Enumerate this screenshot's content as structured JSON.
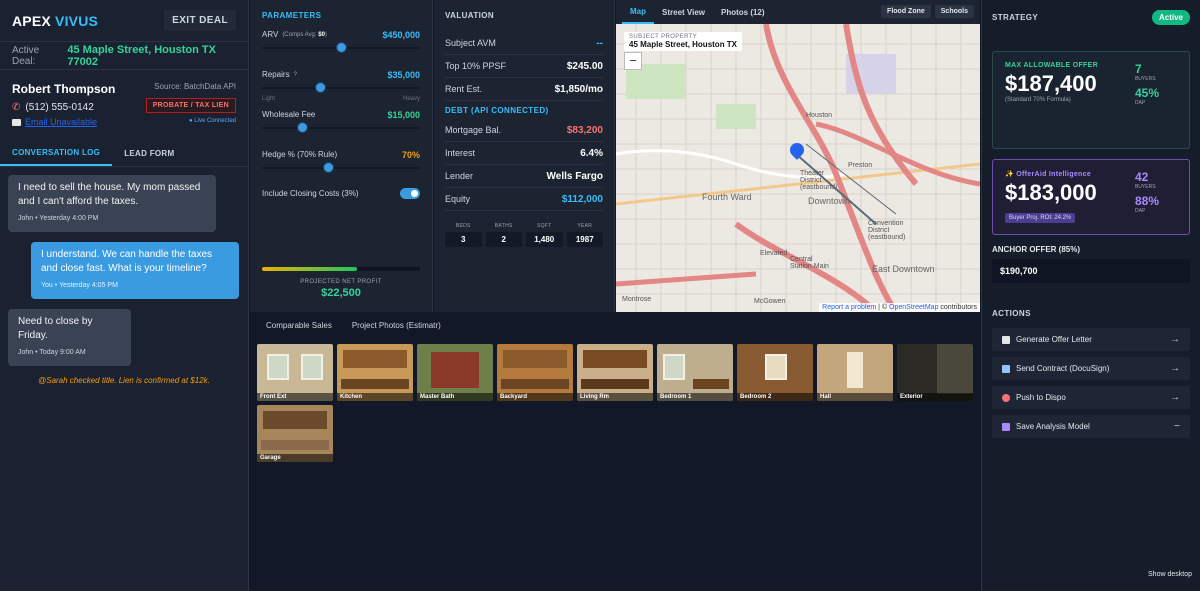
{
  "brand": {
    "part1": "APEX",
    "part2": "VIVUS"
  },
  "exit_label": "EXIT DEAL",
  "deal": {
    "label": "Active Deal:",
    "address": "45 Maple Street, Houston TX 77002"
  },
  "contact": {
    "name": "Robert Thompson",
    "phone": "(512) 555-0142",
    "email": "Email Unavailable",
    "source": "Source: BatchData API",
    "tag": "PROBATE / TAX LIEN",
    "status": "● Live Connected"
  },
  "left_tabs": [
    "CONVERSATION LOG",
    "LEAD FORM"
  ],
  "messages": [
    {
      "text": "I need to sell the house. My mom passed and I can't afford the taxes.",
      "meta": "John • Yesterday 4:00 PM",
      "dir": "in"
    },
    {
      "text": "I understand. We can handle the taxes and close fast. What is your timeline?",
      "meta": "You • Yesterday 4:05 PM",
      "dir": "out"
    },
    {
      "text": "Need to close by Friday.",
      "meta": "John • Today 9:00 AM",
      "dir": "in"
    }
  ],
  "note": "@Sarah checked title. Lien is confirmed at $12k.",
  "parameters": {
    "title": "PARAMETERS",
    "arv": {
      "label": "ARV",
      "sub_label": "(Comps Avg:",
      "sub_value": "$0",
      "sub_end": ")",
      "value": "$450,000",
      "level": 0.5
    },
    "repairs": {
      "label": "Repairs",
      "help": "?",
      "value": "$35,000",
      "level": 0.37,
      "low": "Light",
      "high": "Heavy"
    },
    "wholesale": {
      "label": "Wholesale Fee",
      "value": "$15,000",
      "level": 0.25
    },
    "hedge": {
      "label": "Hedge % (70% Rule)",
      "value": "70%",
      "level": 0.42
    },
    "closing": {
      "label": "Include Closing Costs (3%)",
      "on": true
    },
    "profit_label": "PROJECTED NET PROFIT",
    "profit_value": "$22,500",
    "profit_level": 0.6
  },
  "valuation": {
    "title": "VALUATION",
    "rows": [
      {
        "label": "Subject AVM",
        "value": "--"
      },
      {
        "label": "Top 10% PPSF",
        "value": "$245.00"
      },
      {
        "label": "Rent Est.",
        "value": "$1,850/mo"
      }
    ],
    "debt_title": "DEBT (API CONNECTED)",
    "debt_rows": [
      {
        "label": "Mortgage Bal.",
        "value": "$83,200"
      },
      {
        "label": "Interest",
        "value": "6.4%"
      },
      {
        "label": "Lender",
        "value": "Wells Fargo"
      },
      {
        "label": "Equity",
        "value": "$112,000"
      }
    ],
    "stats": [
      {
        "label": "BEDS",
        "value": "3"
      },
      {
        "label": "BATHS",
        "value": "2"
      },
      {
        "label": "SQFT",
        "value": "1,480"
      },
      {
        "label": "YEAR",
        "value": "1987"
      }
    ]
  },
  "map": {
    "tabs": [
      "Map",
      "Street View",
      "Photos (12)"
    ],
    "buttons": [
      "Flood Zone",
      "Schools"
    ],
    "subject_label": "SUBJECT PROPERTY",
    "subject_address": "45 Maple Street, Houston TX",
    "zoom_out": "−",
    "attrib_report": "Report a problem",
    "attrib_mid": " | © ",
    "attrib_osm": "OpenStreetMap",
    "attrib_end": " contributors",
    "labels": [
      "Fourth Ward",
      "Downtown",
      "East Downtown",
      "Montrose",
      "Elevated",
      "Theater District (eastbound)",
      "Houston",
      "Preston",
      "Central Station Main",
      "McGowen",
      "Convention District (eastbound)"
    ]
  },
  "photo_tabs": [
    "Comparable Sales",
    "Project Photos (Estimatr)"
  ],
  "photos": [
    "Front Ext",
    "Kitchen",
    "Master Bath",
    "Backyard",
    "Living Rm",
    "Bedroom 1",
    "Bedroom 2",
    "Hall",
    "Exterior",
    "Garage"
  ],
  "strategy": {
    "title": "STRATEGY",
    "badge": "Active",
    "mao": {
      "title": "MAX ALLOWABLE OFFER",
      "value": "$187,400",
      "sub": "(Standard 70% Formula)",
      "buyers_n": "7",
      "buyers_l": "BUYERS",
      "dap_n": "45%",
      "dap_l": "DAP"
    },
    "ai": {
      "title": "✨ OfferAid Intelligence",
      "value": "$183,000",
      "roi": "Buyer Proj. ROI: 24.2%",
      "buyers_n": "42",
      "buyers_l": "BUYERS",
      "dap_n": "88%",
      "dap_l": "DAP"
    },
    "anchor_label": "ANCHOR OFFER (85%)",
    "anchor_value": "$190,700",
    "actions_label": "ACTIONS",
    "actions": [
      "Generate Offer Letter",
      "Send Contract (DocuSign)",
      "Push to Dispo",
      "Save Analysis Model"
    ]
  },
  "collapse_glyph": "<",
  "show_desktop": "Show desktop",
  "colors": {
    "accent": "#38bdf8",
    "green": "#34d399",
    "red": "#f87171",
    "purple": "#a78bfa"
  }
}
